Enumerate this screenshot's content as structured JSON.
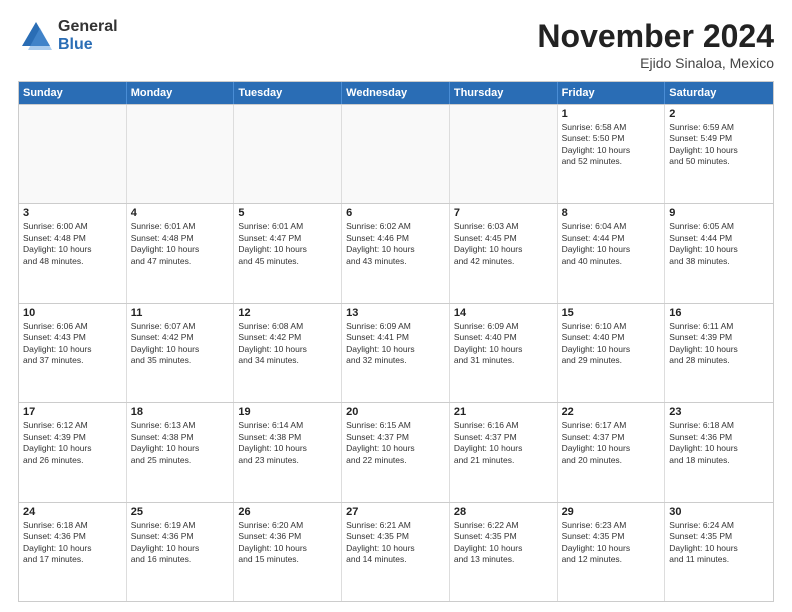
{
  "logo": {
    "general": "General",
    "blue": "Blue"
  },
  "title": "November 2024",
  "location": "Ejido Sinaloa, Mexico",
  "days_of_week": [
    "Sunday",
    "Monday",
    "Tuesday",
    "Wednesday",
    "Thursday",
    "Friday",
    "Saturday"
  ],
  "weeks": [
    [
      {
        "day": "",
        "empty": true,
        "info": ""
      },
      {
        "day": "",
        "empty": true,
        "info": ""
      },
      {
        "day": "",
        "empty": true,
        "info": ""
      },
      {
        "day": "",
        "empty": true,
        "info": ""
      },
      {
        "day": "",
        "empty": true,
        "info": ""
      },
      {
        "day": "1",
        "empty": false,
        "info": "Sunrise: 6:58 AM\nSunset: 5:50 PM\nDaylight: 10 hours\nand 52 minutes."
      },
      {
        "day": "2",
        "empty": false,
        "info": "Sunrise: 6:59 AM\nSunset: 5:49 PM\nDaylight: 10 hours\nand 50 minutes."
      }
    ],
    [
      {
        "day": "3",
        "empty": false,
        "info": "Sunrise: 6:00 AM\nSunset: 4:48 PM\nDaylight: 10 hours\nand 48 minutes."
      },
      {
        "day": "4",
        "empty": false,
        "info": "Sunrise: 6:01 AM\nSunset: 4:48 PM\nDaylight: 10 hours\nand 47 minutes."
      },
      {
        "day": "5",
        "empty": false,
        "info": "Sunrise: 6:01 AM\nSunset: 4:47 PM\nDaylight: 10 hours\nand 45 minutes."
      },
      {
        "day": "6",
        "empty": false,
        "info": "Sunrise: 6:02 AM\nSunset: 4:46 PM\nDaylight: 10 hours\nand 43 minutes."
      },
      {
        "day": "7",
        "empty": false,
        "info": "Sunrise: 6:03 AM\nSunset: 4:45 PM\nDaylight: 10 hours\nand 42 minutes."
      },
      {
        "day": "8",
        "empty": false,
        "info": "Sunrise: 6:04 AM\nSunset: 4:44 PM\nDaylight: 10 hours\nand 40 minutes."
      },
      {
        "day": "9",
        "empty": false,
        "info": "Sunrise: 6:05 AM\nSunset: 4:44 PM\nDaylight: 10 hours\nand 38 minutes."
      }
    ],
    [
      {
        "day": "10",
        "empty": false,
        "info": "Sunrise: 6:06 AM\nSunset: 4:43 PM\nDaylight: 10 hours\nand 37 minutes."
      },
      {
        "day": "11",
        "empty": false,
        "info": "Sunrise: 6:07 AM\nSunset: 4:42 PM\nDaylight: 10 hours\nand 35 minutes."
      },
      {
        "day": "12",
        "empty": false,
        "info": "Sunrise: 6:08 AM\nSunset: 4:42 PM\nDaylight: 10 hours\nand 34 minutes."
      },
      {
        "day": "13",
        "empty": false,
        "info": "Sunrise: 6:09 AM\nSunset: 4:41 PM\nDaylight: 10 hours\nand 32 minutes."
      },
      {
        "day": "14",
        "empty": false,
        "info": "Sunrise: 6:09 AM\nSunset: 4:40 PM\nDaylight: 10 hours\nand 31 minutes."
      },
      {
        "day": "15",
        "empty": false,
        "info": "Sunrise: 6:10 AM\nSunset: 4:40 PM\nDaylight: 10 hours\nand 29 minutes."
      },
      {
        "day": "16",
        "empty": false,
        "info": "Sunrise: 6:11 AM\nSunset: 4:39 PM\nDaylight: 10 hours\nand 28 minutes."
      }
    ],
    [
      {
        "day": "17",
        "empty": false,
        "info": "Sunrise: 6:12 AM\nSunset: 4:39 PM\nDaylight: 10 hours\nand 26 minutes."
      },
      {
        "day": "18",
        "empty": false,
        "info": "Sunrise: 6:13 AM\nSunset: 4:38 PM\nDaylight: 10 hours\nand 25 minutes."
      },
      {
        "day": "19",
        "empty": false,
        "info": "Sunrise: 6:14 AM\nSunset: 4:38 PM\nDaylight: 10 hours\nand 23 minutes."
      },
      {
        "day": "20",
        "empty": false,
        "info": "Sunrise: 6:15 AM\nSunset: 4:37 PM\nDaylight: 10 hours\nand 22 minutes."
      },
      {
        "day": "21",
        "empty": false,
        "info": "Sunrise: 6:16 AM\nSunset: 4:37 PM\nDaylight: 10 hours\nand 21 minutes."
      },
      {
        "day": "22",
        "empty": false,
        "info": "Sunrise: 6:17 AM\nSunset: 4:37 PM\nDaylight: 10 hours\nand 20 minutes."
      },
      {
        "day": "23",
        "empty": false,
        "info": "Sunrise: 6:18 AM\nSunset: 4:36 PM\nDaylight: 10 hours\nand 18 minutes."
      }
    ],
    [
      {
        "day": "24",
        "empty": false,
        "info": "Sunrise: 6:18 AM\nSunset: 4:36 PM\nDaylight: 10 hours\nand 17 minutes."
      },
      {
        "day": "25",
        "empty": false,
        "info": "Sunrise: 6:19 AM\nSunset: 4:36 PM\nDaylight: 10 hours\nand 16 minutes."
      },
      {
        "day": "26",
        "empty": false,
        "info": "Sunrise: 6:20 AM\nSunset: 4:36 PM\nDaylight: 10 hours\nand 15 minutes."
      },
      {
        "day": "27",
        "empty": false,
        "info": "Sunrise: 6:21 AM\nSunset: 4:35 PM\nDaylight: 10 hours\nand 14 minutes."
      },
      {
        "day": "28",
        "empty": false,
        "info": "Sunrise: 6:22 AM\nSunset: 4:35 PM\nDaylight: 10 hours\nand 13 minutes."
      },
      {
        "day": "29",
        "empty": false,
        "info": "Sunrise: 6:23 AM\nSunset: 4:35 PM\nDaylight: 10 hours\nand 12 minutes."
      },
      {
        "day": "30",
        "empty": false,
        "info": "Sunrise: 6:24 AM\nSunset: 4:35 PM\nDaylight: 10 hours\nand 11 minutes."
      }
    ]
  ]
}
